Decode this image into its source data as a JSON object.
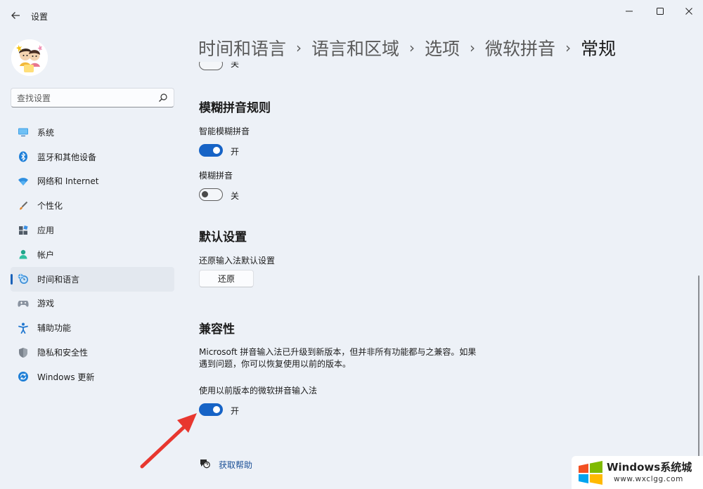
{
  "app": {
    "title": "设置",
    "back_icon": "back-arrow-icon"
  },
  "window_controls": {
    "minimize_icon": "minimize-icon",
    "maximize_icon": "maximize-icon",
    "close_icon": "close-icon"
  },
  "search": {
    "placeholder": "查找设置",
    "icon": "search-icon"
  },
  "sidebar": {
    "items": [
      {
        "label": "系统",
        "icon": "system-icon"
      },
      {
        "label": "蓝牙和其他设备",
        "icon": "bluetooth-icon"
      },
      {
        "label": "网络和 Internet",
        "icon": "network-icon"
      },
      {
        "label": "个性化",
        "icon": "personalization-icon"
      },
      {
        "label": "应用",
        "icon": "apps-icon"
      },
      {
        "label": "帐户",
        "icon": "account-icon"
      },
      {
        "label": "时间和语言",
        "icon": "time-language-icon",
        "active": true
      },
      {
        "label": "游戏",
        "icon": "gaming-icon"
      },
      {
        "label": "辅助功能",
        "icon": "accessibility-icon"
      },
      {
        "label": "隐私和安全性",
        "icon": "privacy-shield-icon"
      },
      {
        "label": "Windows 更新",
        "icon": "windows-update-icon"
      }
    ]
  },
  "breadcrumb": {
    "items": [
      "时间和语言",
      "语言和区域",
      "选项",
      "微软拼音",
      "常规"
    ],
    "separator": "›"
  },
  "content": {
    "partial_toggle_label": "关",
    "fuzzy": {
      "title": "模糊拼音规则",
      "smart_label": "智能模糊拼音",
      "smart_state": "开",
      "fuzzy_label": "模糊拼音",
      "fuzzy_state": "关"
    },
    "defaults": {
      "title": "默认设置",
      "restore_label": "还原输入法默认设置",
      "restore_button": "还原"
    },
    "compat": {
      "title": "兼容性",
      "description": "Microsoft 拼音输入法已升级到新版本，但并非所有功能都与之兼容。如果遇到问题，你可以恢复使用以前的版本。",
      "legacy_label": "使用以前版本的微软拼音输入法",
      "legacy_state": "开"
    },
    "help": {
      "label": "获取帮助",
      "icon": "help-icon"
    }
  },
  "annotation": {
    "arrow_color": "#e8372f"
  },
  "watermark": {
    "title": "Windows系统城",
    "url": "www.wxclgg.com"
  },
  "colors": {
    "accent": "#1663c6",
    "background": "#edf1f7"
  }
}
